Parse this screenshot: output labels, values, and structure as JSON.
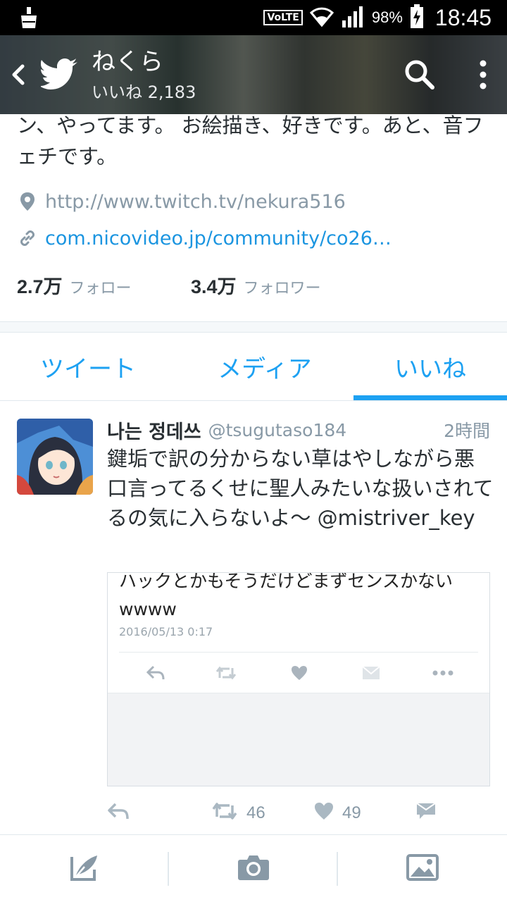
{
  "status_bar": {
    "network_badge": "VoLTE",
    "battery_percent": "98%",
    "time": "18:45"
  },
  "header": {
    "title": "ねくら",
    "subtitle": "いいね 2,183"
  },
  "profile": {
    "bio": "ン、やってます。 お絵描き、好きです。あと、音フェチです。",
    "location_url": "http://www.twitch.tv/nekura516",
    "website": "com.nicovideo.jp/community/co26…",
    "following_count": "2.7万",
    "following_label": "フォロー",
    "followers_count": "3.4万",
    "followers_label": "フォロワー"
  },
  "tabs": [
    {
      "label": "ツイート",
      "active": false
    },
    {
      "label": "メディア",
      "active": false
    },
    {
      "label": "いいね",
      "active": true
    }
  ],
  "tweet": {
    "author_name": "나는 정데쓰",
    "author_handle": "@tsugutaso184",
    "time": "2時間",
    "text": "鍵垢で訳の分からない草はやしながら悪口言ってるくせに聖人みたいな扱いされてるの気に入らないよ～ @mistriver_key",
    "embed": {
      "text": "ハックとかもそうだけどまずセンスかないwwww",
      "date": "2016/05/13 0:17"
    },
    "retweet_count": "46",
    "like_count": "49"
  },
  "icons": {
    "back": "back-arrow-icon",
    "logo": "twitter-bird-icon",
    "search": "search-icon",
    "more": "more-vertical-icon",
    "location": "location-pin-icon",
    "link": "link-icon",
    "reply": "reply-icon",
    "retweet": "retweet-icon",
    "like": "heart-icon",
    "dm": "envelope-icon",
    "compose": "compose-icon",
    "camera": "camera-icon",
    "gallery": "gallery-icon"
  },
  "colors": {
    "accent": "#1da1f2",
    "link": "#1b95e0",
    "muted": "#8899a6",
    "text": "#292f33"
  }
}
